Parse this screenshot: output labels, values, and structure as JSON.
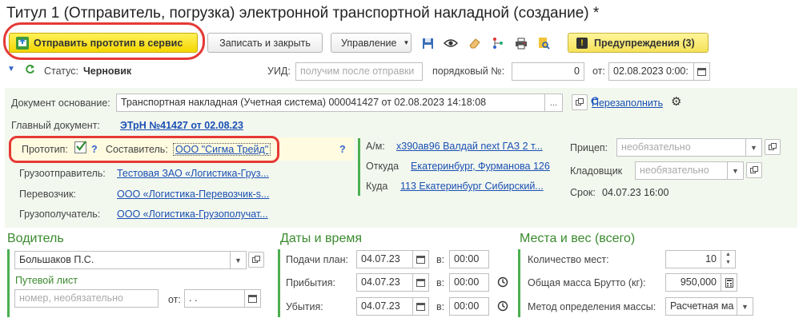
{
  "window": {
    "title": "Титул 1 (Отправитель, погрузка) электронной транспортной накладной (создание) *"
  },
  "toolbar": {
    "send_label": "Отправить прототип в сервис",
    "save_close_label": "Записать и закрыть",
    "manage_label": "Управление",
    "warnings_label": "Предупреждения (3)"
  },
  "status": {
    "label": "Статус:",
    "value": "Черновик",
    "uid_label": "УИД:",
    "uid_placeholder": "получим после отправки",
    "seq_label": "порядковый №:",
    "seq_value": "0",
    "from_label": "от:",
    "date_value": "02.08.2023  0:00:"
  },
  "header": {
    "base_doc_label": "Документ основание:",
    "base_doc_value": "Транспортная накладная (Учетная система) 000041427 от 02.08.2023 14:18:08",
    "refill_link": "Перезаполнить",
    "main_doc_label": "Главный документ:",
    "main_doc_link": "ЭТрН №41427 от 02.08.23"
  },
  "parties": {
    "prototype_label": "Прототип:",
    "help": "?",
    "composer_label": "Составитель:",
    "composer_link": "ООО \"Сигма Трейд\"",
    "shipper_label": "Грузоотправитель:",
    "shipper_link": "Тестовая ЗАО «Логистика-Груз...",
    "carrier_label": "Перевозчик:",
    "carrier_link": "ООО «Логистика-Перевозчик-s...",
    "consignee_label": "Грузополучатель:",
    "consignee_link": "ООО «Логистика-Грузополучат..."
  },
  "route": {
    "vehicle_label": "А/м:",
    "vehicle_link": "х390ав96 Валдай next ГАЗ 2 т...",
    "from_label": "Откуда",
    "from_link": "Екатеринбург, Фурманова 126",
    "to_label": "Куда",
    "to_link": "113 Екатеринбург Сибирский...",
    "term_label": "Срок:",
    "term_value": "04.07.23 16:00",
    "trailer_label": "Прицеп:",
    "trailer_placeholder": "необязательно",
    "storekeeper_label": "Кладовщик",
    "storekeeper_placeholder": "необязательно"
  },
  "driver": {
    "heading": "Водитель",
    "name": "Большаков П.С.",
    "waybill_label": "Путевой лист",
    "waybill_placeholder": "номер,  необязательно",
    "from_label": "от:",
    "date_value": "  .  ."
  },
  "dates": {
    "heading": "Даты и время",
    "submit_label": "Подачи план:",
    "submit_date": "04.07.23",
    "submit_time": "00:00",
    "arrival_label": "Прибытия:",
    "arrival_date": "04.07.23",
    "arrival_time": "00:00",
    "departure_label": "Убытия:",
    "departure_date": "04.07.23",
    "departure_time": "00:00",
    "at_label": "в:"
  },
  "places": {
    "heading": "Места и вес (всего)",
    "count_label": "Количество мест:",
    "count_value": "10",
    "gross_label": "Общая масса Брутто (кг):",
    "gross_value": "950,000",
    "method_label": "Метод определения массы:",
    "method_value": "Расчетная ма"
  },
  "colors": {
    "accent_green": "#3a8a2e",
    "link_blue": "#1a4fb3",
    "highlight_red": "#e53935",
    "primary_yellow": "#f4d600"
  }
}
